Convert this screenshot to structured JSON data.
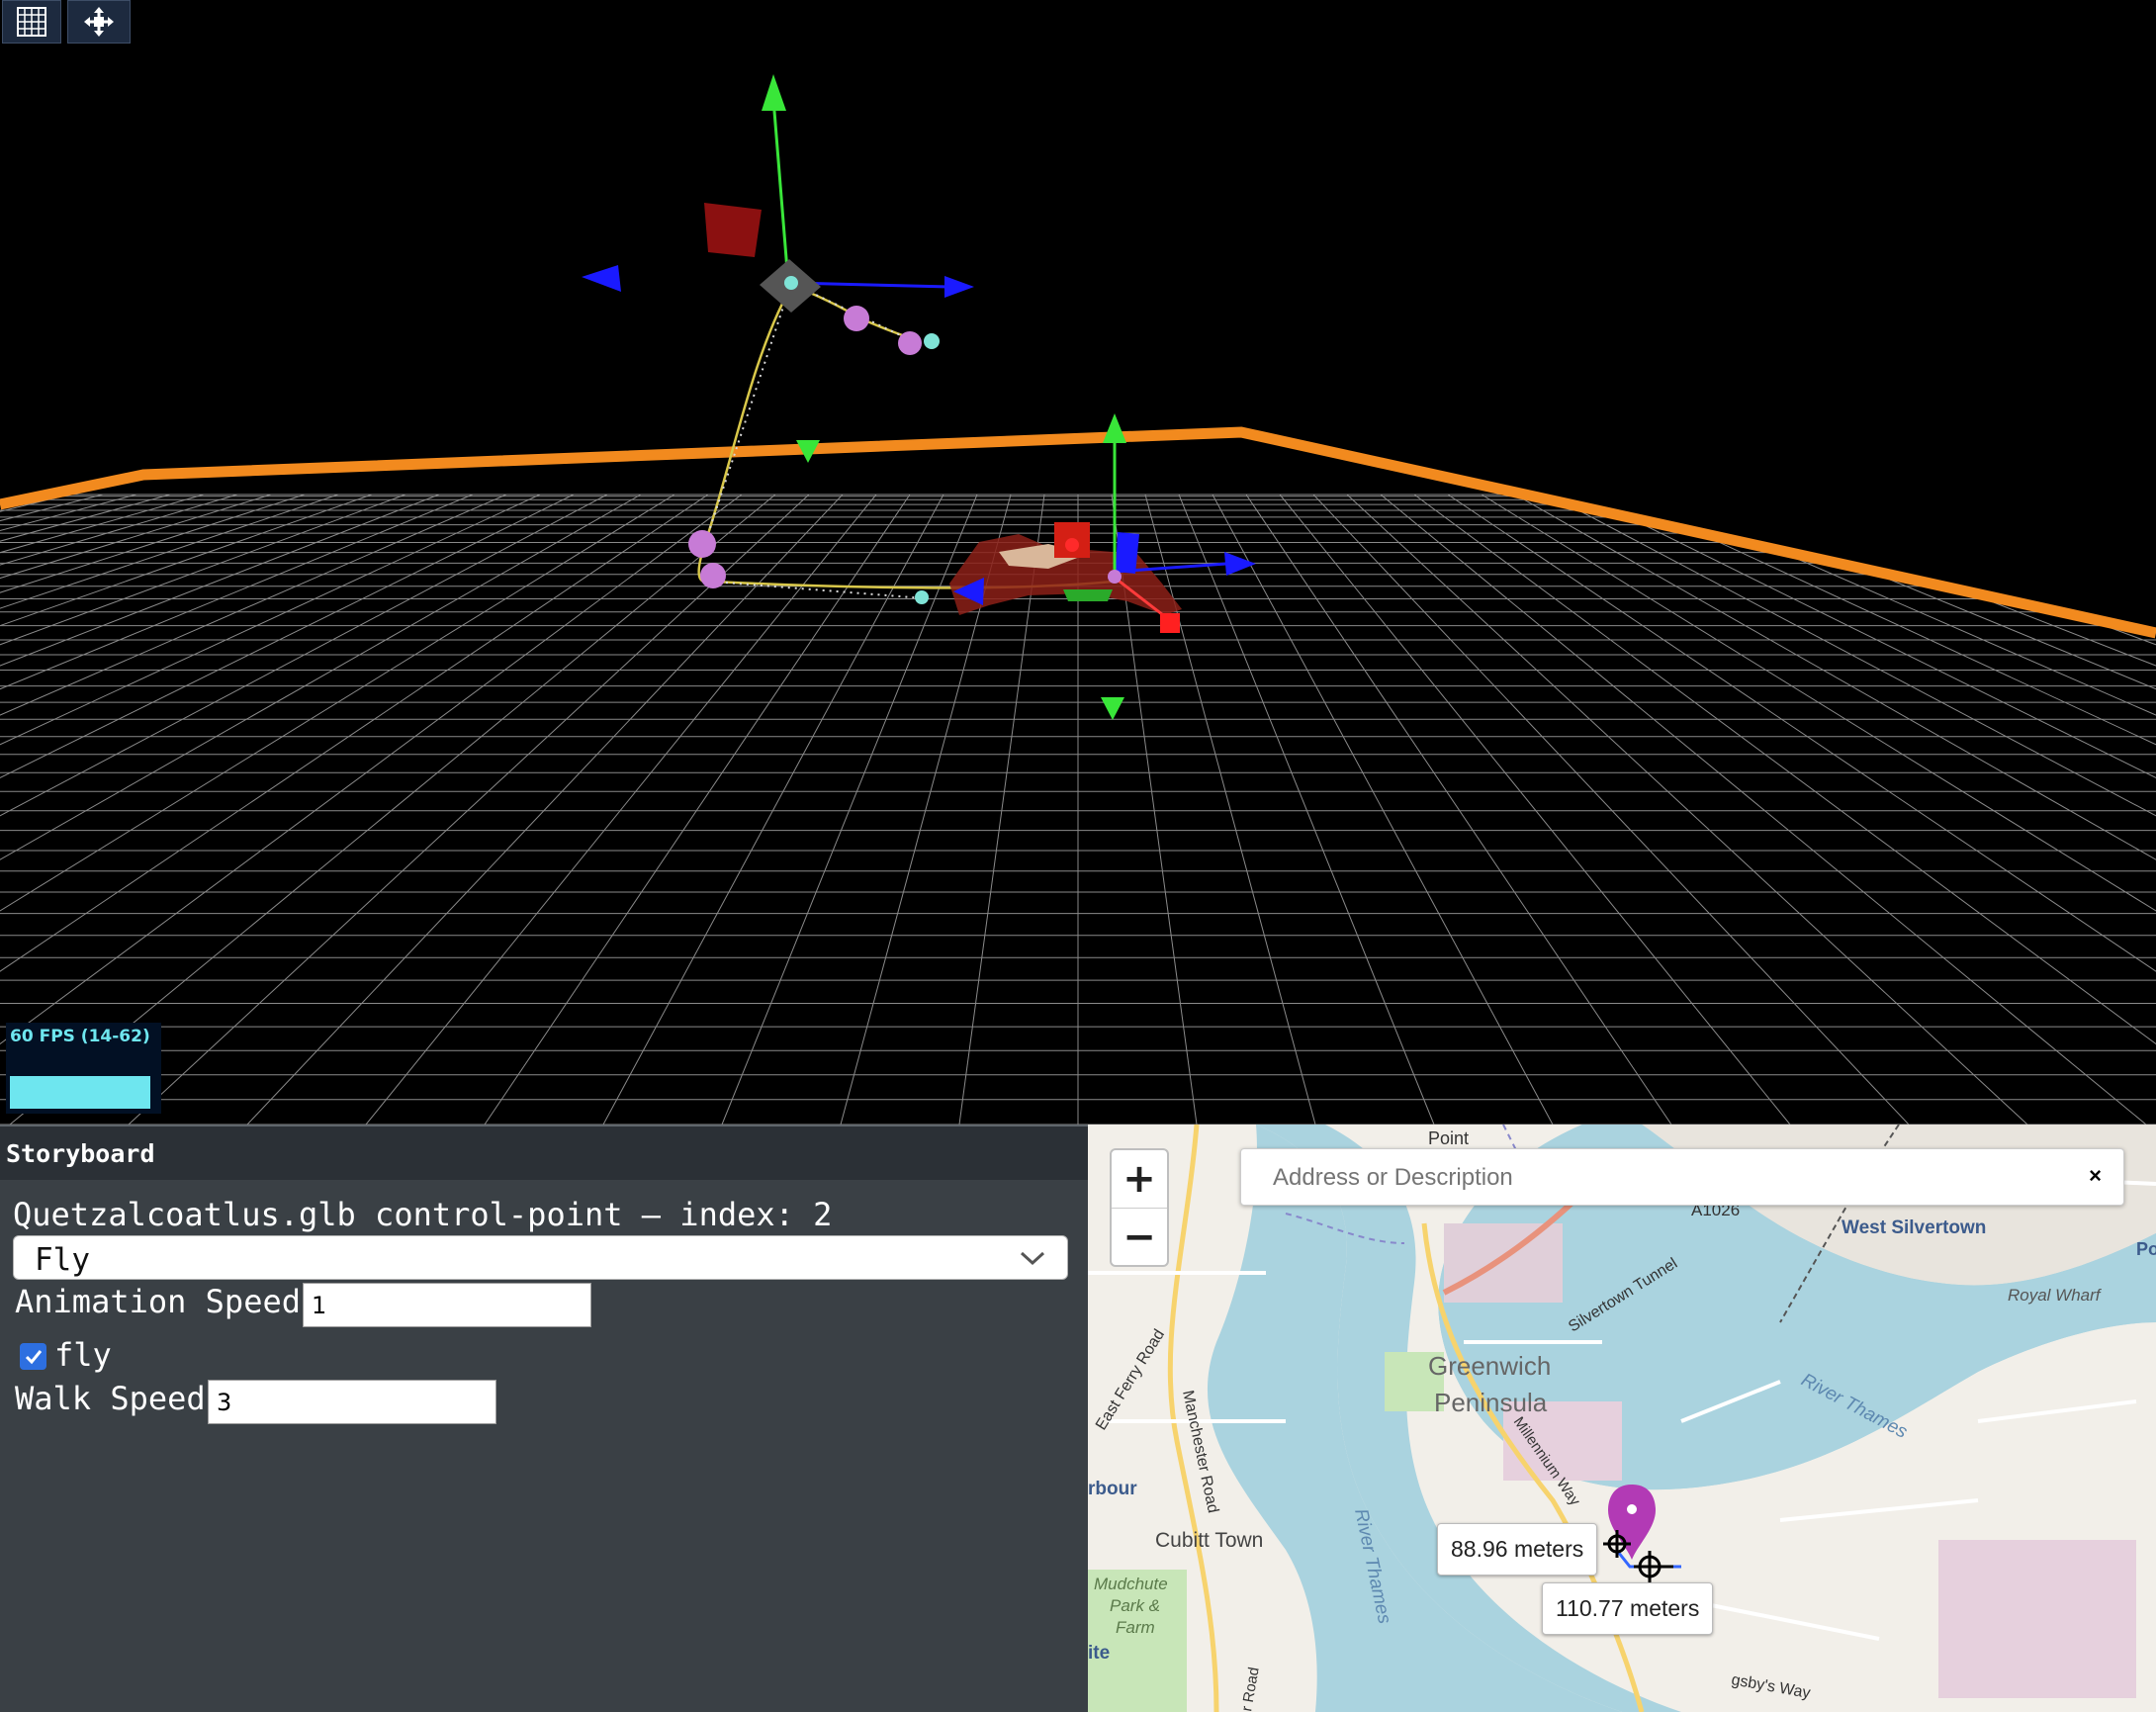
{
  "toolbar": {
    "buttons": [
      {
        "icon": "grid-icon"
      },
      {
        "icon": "move-arrows-icon"
      }
    ]
  },
  "viewport": {
    "fps_label": "60 FPS (14-62)",
    "fps_fraction": 0.96
  },
  "storyboard": {
    "title": "Storyboard",
    "subtitle": "Quetzalcoatlus.glb control-point – index: 2",
    "mode_select": {
      "value": "Fly"
    },
    "animation_speed": {
      "label": "Animation Speed",
      "value": "1"
    },
    "fly": {
      "label": "fly",
      "checked": true
    },
    "walk_speed": {
      "label": "Walk Speed",
      "value": "3"
    }
  },
  "map": {
    "zoom_in_label": "+",
    "zoom_out_label": "−",
    "search": {
      "placeholder": "Address or Description",
      "clear_label": "×"
    },
    "labels": {
      "point": "Point",
      "a1026": "A1026",
      "west_silvertown": "West Silvertown",
      "royal_wharf": "Royal Wharf",
      "silvertown_tunnel": "Silvertown Tunnel",
      "greenwich": "Greenwich",
      "peninsula": "Peninsula",
      "east_ferry_road": "East Ferry Road",
      "manchester_road": "Manchester Road",
      "millennium_way": "Millennium Way",
      "river_thames_east": "River Thames",
      "river_thames_south": "River Thames",
      "cubitt_town": "Cubitt Town",
      "mudchute": "Mudchute",
      "park_and": "Park &",
      "farm": "Farm",
      "rbour": "rbour",
      "ite": "ite",
      "r_road": "r Road",
      "gsbys_way": "gsby's Way",
      "po": "Po"
    },
    "measurements": [
      {
        "text": "88.96 meters"
      },
      {
        "text": "110.77 meters"
      }
    ],
    "colors": {
      "water": "#aad3df",
      "land": "#f2efe9",
      "marker": "#b23ab5"
    }
  }
}
